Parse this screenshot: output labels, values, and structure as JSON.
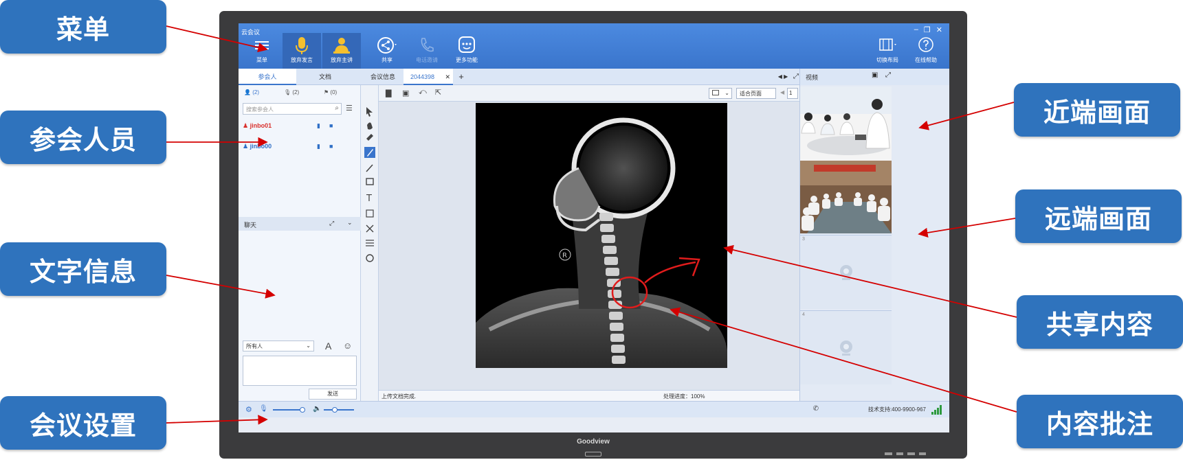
{
  "callouts": {
    "menu": "菜单",
    "participants": "参会人员",
    "text_info": "文字信息",
    "meeting_settings": "会议设置",
    "near_end": "近端画面",
    "far_end": "远端画面",
    "shared_content": "共享内容",
    "annotation": "内容批注"
  },
  "monitor": {
    "brand": "Goodview"
  },
  "app": {
    "title": "云会议",
    "toolbar": {
      "menu": "菜单",
      "give_up_speak": "放弃发言",
      "give_up_host": "放弃主讲",
      "share": "共享",
      "phone_invite": "电话邀请",
      "more": "更多功能",
      "switch_layout": "切换布局",
      "online_help": "在线帮助"
    },
    "left_tabs": {
      "participants": "参会人",
      "docs": "文档"
    },
    "doc_tabs": {
      "meeting_info": "会议信息",
      "doc_id": "2044398",
      "close": "✕",
      "add": "+"
    },
    "counts": {
      "people": "(2)",
      "mics": "(2)",
      "flags": "(0)"
    },
    "search_placeholder": "搜索参会人",
    "participants": [
      {
        "name": "jinbo01",
        "color": "#d9302c"
      },
      {
        "name": "jinbo00",
        "color": "#2f6fc6"
      }
    ],
    "chat": {
      "title": "聊天",
      "recipient": "所有人",
      "send": "发送"
    },
    "viewer": {
      "fit_page": "适合页面",
      "page": "1"
    },
    "status": {
      "upload": "上传文档完成.",
      "progress": "处理进度：100%"
    },
    "video": {
      "title": "视频",
      "slot3": "3",
      "slot4": "4"
    },
    "support": "技术支持:400-9900-967"
  },
  "colors": {
    "callout_bg": "#2f73bd",
    "titlebar": "#3a75cc",
    "arrow": "#d40000"
  }
}
